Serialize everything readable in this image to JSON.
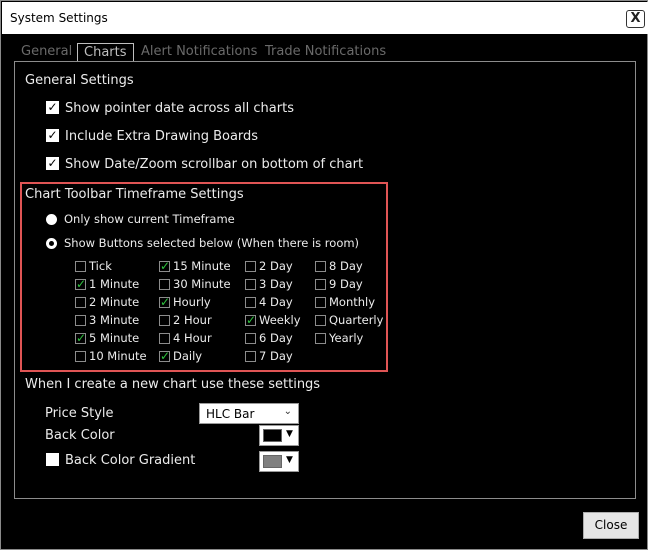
{
  "window": {
    "title": "System Settings",
    "close_glyph": "X"
  },
  "tabs": [
    {
      "label": "General"
    },
    {
      "label": "Charts"
    },
    {
      "label": "Alert Notifications"
    },
    {
      "label": "Trade Notifications"
    }
  ],
  "general": {
    "heading": "General Settings",
    "options": [
      {
        "label": "Show pointer date across all charts",
        "checked": true
      },
      {
        "label": "Include Extra Drawing Boards",
        "checked": true
      },
      {
        "label": "Show Date/Zoom scrollbar on bottom of chart",
        "checked": true
      }
    ]
  },
  "toolbar": {
    "heading": "Chart Toolbar Timeframe Settings",
    "radio_current": "Only show current Timeframe",
    "radio_buttons": "Show Buttons selected below (When there is room)",
    "columns": [
      [
        {
          "label": "Tick",
          "checked": false
        },
        {
          "label": "1 Minute",
          "checked": true
        },
        {
          "label": "2 Minute",
          "checked": false
        },
        {
          "label": "3 Minute",
          "checked": false
        },
        {
          "label": "5 Minute",
          "checked": true
        },
        {
          "label": "10 Minute",
          "checked": false
        }
      ],
      [
        {
          "label": "15 Minute",
          "checked": true
        },
        {
          "label": "30 Minute",
          "checked": false
        },
        {
          "label": "Hourly",
          "checked": true
        },
        {
          "label": "2 Hour",
          "checked": false
        },
        {
          "label": "4 Hour",
          "checked": false
        },
        {
          "label": "Daily",
          "checked": true
        }
      ],
      [
        {
          "label": "2 Day",
          "checked": false
        },
        {
          "label": "3 Day",
          "checked": false
        },
        {
          "label": "4 Day",
          "checked": false
        },
        {
          "label": "Weekly",
          "checked": true
        },
        {
          "label": "6 Day",
          "checked": false
        },
        {
          "label": "7 Day",
          "checked": false
        }
      ],
      [
        {
          "label": "8 Day",
          "checked": false
        },
        {
          "label": "9 Day",
          "checked": false
        },
        {
          "label": "Monthly",
          "checked": false
        },
        {
          "label": "Quarterly",
          "checked": false
        },
        {
          "label": "Yearly",
          "checked": false
        }
      ]
    ]
  },
  "newchart": {
    "heading": "When I create a new chart use these settings",
    "price_style_label": "Price Style",
    "price_style_value": "HLC Bar",
    "back_color_label": "Back Color",
    "back_color_value": "#000000",
    "gradient_label": "Back Color Gradient",
    "gradient_color_value": "#808080"
  },
  "footer": {
    "close_label": "Close"
  },
  "colors": {
    "window_bg": "#000000",
    "highlight_box": "#e05555",
    "check_green": "#2ec13e",
    "text": "#ececec"
  }
}
